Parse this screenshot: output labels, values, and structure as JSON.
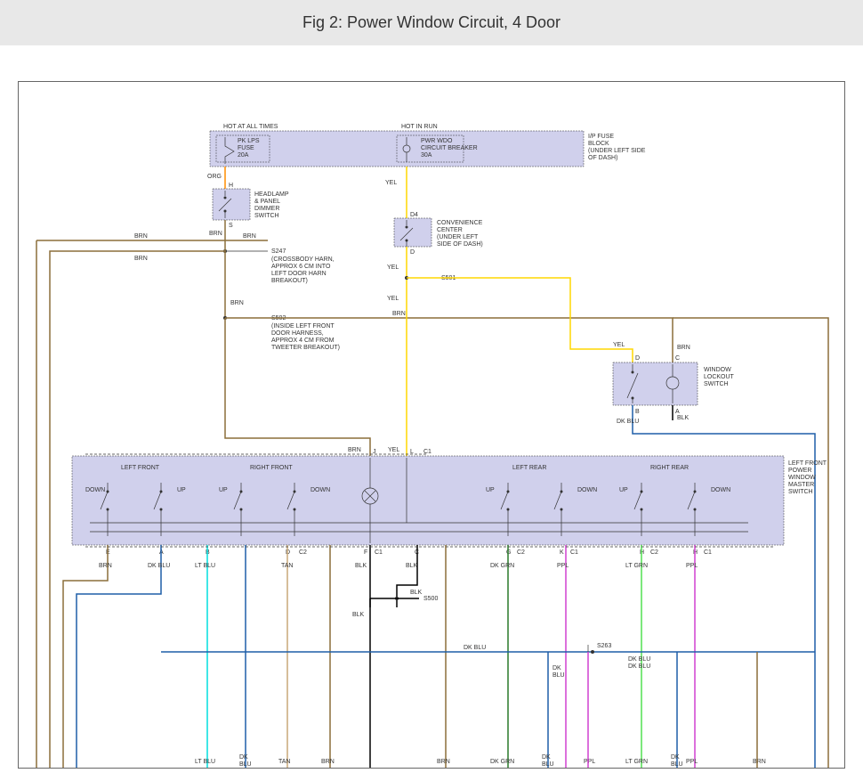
{
  "title": "Fig 2: Power Window Circuit, 4 Door",
  "labels": {
    "hot_always": "HOT AT ALL TIMES",
    "hot_run": "HOT IN RUN",
    "fuse_block": "I/P FUSE BLOCK (UNDER LEFT SIDE OF DASH)",
    "pk_lps": "PK LPS FUSE 20A",
    "pwr_wdo": "PWR WDO CIRCUIT BREAKER 30A",
    "headlamp": "HEADLAMP & PANEL DIMMER SWITCH",
    "convenience": "CONVENIENCE CENTER (UNDER LEFT SIDE OF DASH)",
    "s247": "S247",
    "s247_desc": "(CROSSBODY HARN, APPROX 6 CM INTO LEFT DOOR HARN BREAKOUT)",
    "s502": "S502",
    "s502_desc": "(INSIDE LEFT FRONT DOOR HARNESS, APPROX 4 CM FROM TWEETER BREAKOUT)",
    "s501": "S501",
    "s263": "S263",
    "s500": "S500",
    "lockout": "WINDOW LOCKOUT SWITCH",
    "master": "LEFT FRONT POWER WINDOW MASTER SWITCH",
    "left_front": "LEFT FRONT",
    "right_front": "RIGHT FRONT",
    "left_rear": "LEFT REAR",
    "right_rear": "RIGHT REAR",
    "down": "DOWN",
    "up": "UP",
    "brn": "BRN",
    "org": "ORG",
    "yel": "YEL",
    "blk": "BLK",
    "dkblu": "DK BLU",
    "ltblu": "LT BLU",
    "tan": "TAN",
    "dkgrn": "DK GRN",
    "ppl": "PPL",
    "ltgrn": "LT GRN",
    "c1": "C1",
    "c2": "C2",
    "d4": "D4",
    "pins": {
      "a": "A",
      "b": "B",
      "c": "C",
      "d": "D",
      "e": "E",
      "f": "F",
      "g": "G",
      "h": "H",
      "j": "J",
      "k": "K",
      "l": "L",
      "s": "S"
    }
  }
}
